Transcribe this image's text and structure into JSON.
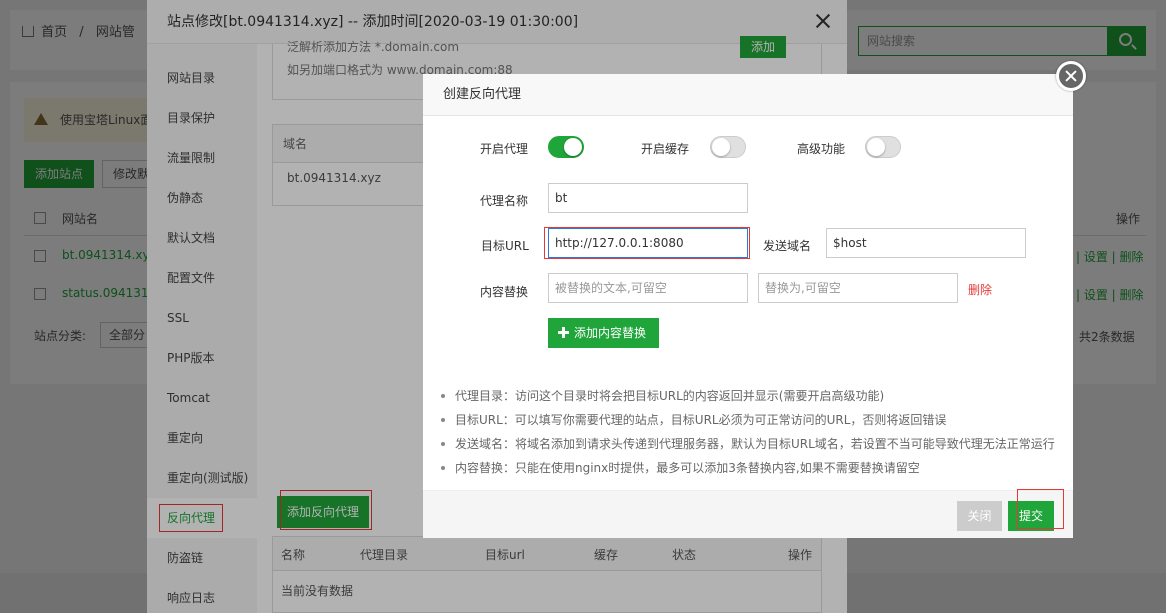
{
  "colors": {
    "accent": "#20a53a",
    "danger": "#e53935",
    "focus": "#2b78e4"
  },
  "background": {
    "breadcrumb": [
      "首页",
      "/",
      "网站管"
    ],
    "search_placeholder": "网站搜索",
    "warning_text": "使用宝塔Linux面",
    "add_site_label": "添加站点",
    "modify_label": "修改默",
    "table_header": {
      "name": "网站名",
      "actions": "操作"
    },
    "rows": [
      {
        "name": "bt.0941314.xyz",
        "actions": "| 设置 | 删除"
      },
      {
        "name": "status.0941314",
        "actions": "| 设置 | 删除"
      }
    ],
    "category_label": "站点分类:",
    "category_value": "全部分",
    "total": "共2条数据"
  },
  "edit_dialog": {
    "title": "站点修改[bt.0941314.xyz] -- 添加时间[2020-03-19 01:30:00]",
    "menu": [
      {
        "label": "网站目录",
        "active": false
      },
      {
        "label": "目录保护",
        "active": false
      },
      {
        "label": "流量限制",
        "active": false
      },
      {
        "label": "伪静态",
        "active": false
      },
      {
        "label": "默认文档",
        "active": false
      },
      {
        "label": "配置文件",
        "active": false
      },
      {
        "label": "SSL",
        "active": false
      },
      {
        "label": "PHP版本",
        "active": false
      },
      {
        "label": "Tomcat",
        "active": false
      },
      {
        "label": "重定向",
        "active": false
      },
      {
        "label": "重定向(测试版)",
        "active": false
      },
      {
        "label": "反向代理",
        "active": true
      },
      {
        "label": "防盗链",
        "active": false
      },
      {
        "label": "响应日志",
        "active": false
      }
    ],
    "domain_hints": [
      "泛解析添加方法 *.domain.com",
      "如另加端口格式为 www.domain.com:88"
    ],
    "add_domain_label": "添加",
    "domain_table": {
      "header": "域名",
      "row": "bt.0941314.xyz"
    },
    "add_proxy_label": "添加反向代理",
    "proxy_table": {
      "headers": [
        "名称",
        "代理目录",
        "目标url",
        "缓存",
        "状态",
        "操作"
      ],
      "empty": "当前没有数据"
    }
  },
  "proxy_dialog": {
    "title": "创建反向代理",
    "enable_proxy": {
      "label": "开启代理",
      "on": true
    },
    "enable_cache": {
      "label": "开启缓存",
      "on": false
    },
    "advanced": {
      "label": "高级功能",
      "on": false
    },
    "proxy_name": {
      "label": "代理名称",
      "value": "bt"
    },
    "target_url": {
      "label": "目标URL",
      "value": "http://127.0.0.1:8080"
    },
    "send_domain": {
      "label": "发送域名",
      "value": "$host"
    },
    "content_replace": {
      "label": "内容替换",
      "from_placeholder": "被替换的文本,可留空",
      "to_placeholder": "替换为,可留空",
      "delete_label": "删除"
    },
    "add_replace_label": "添加内容替换",
    "tips": [
      "代理目录：访问这个目录时将会把目标URL的内容返回并显示(需要开启高级功能)",
      "目标URL：可以填写你需要代理的站点，目标URL必须为可正常访问的URL，否则将返回错误",
      "发送域名：将域名添加到请求头传递到代理服务器，默认为目标URL域名，若设置不当可能导致代理无法正常运行",
      "内容替换：只能在使用nginx时提供，最多可以添加3条替换内容,如果不需要替换请留空"
    ],
    "close_label": "关闭",
    "submit_label": "提交"
  }
}
